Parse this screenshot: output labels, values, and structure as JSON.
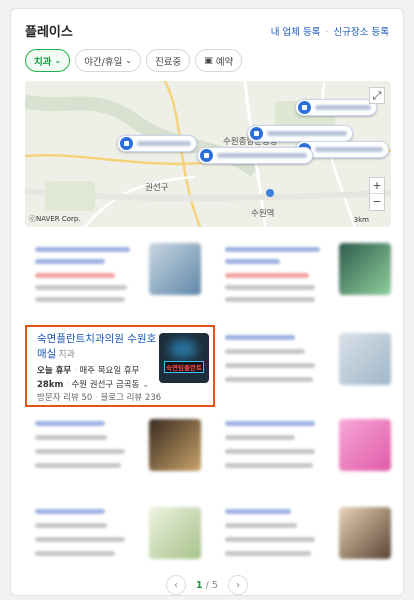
{
  "header": {
    "title": "플레이스",
    "link_register": "내 업체 등록",
    "link_separator": "·",
    "link_new": "신규장소 등록"
  },
  "filters": [
    {
      "label": "치과",
      "icon": "chevron-down-icon",
      "active": true
    },
    {
      "label": "야간/휴일",
      "icon": "chevron-down-icon",
      "active": false
    },
    {
      "label": "진료중",
      "active": false
    },
    {
      "label": "예약",
      "icon": "calendar-icon",
      "active": false
    }
  ],
  "map": {
    "labels": {
      "district1": "권선구",
      "district2": "수원",
      "station": "수원역",
      "mid1": "수원종합운동장"
    },
    "attribution": "ⓒNAVER Corp.",
    "scale": "3km",
    "controls": {
      "zoom_in": "+",
      "zoom_out": "−",
      "expand": "⤢"
    }
  },
  "featured": {
    "name": "숙면플란트치과의원 수원호매실",
    "category": "지과",
    "hours_status": "오늘 휴무",
    "hours_detail": "매주 목요일 휴무",
    "distance": "28km",
    "address": "수원 권선구 금곡동",
    "visitor_reviews": "방문자 리뷰 50",
    "blog_reviews": "블로그 리뷰 236",
    "thumb_text": "숙면임플란트"
  },
  "pagination": {
    "current": "1",
    "total": "5",
    "separator": " / ",
    "prev": "‹",
    "next": "›"
  },
  "colors": {
    "accent_green": "#21b34b",
    "link_blue": "#1a56b3",
    "highlight": "#e2541a"
  }
}
